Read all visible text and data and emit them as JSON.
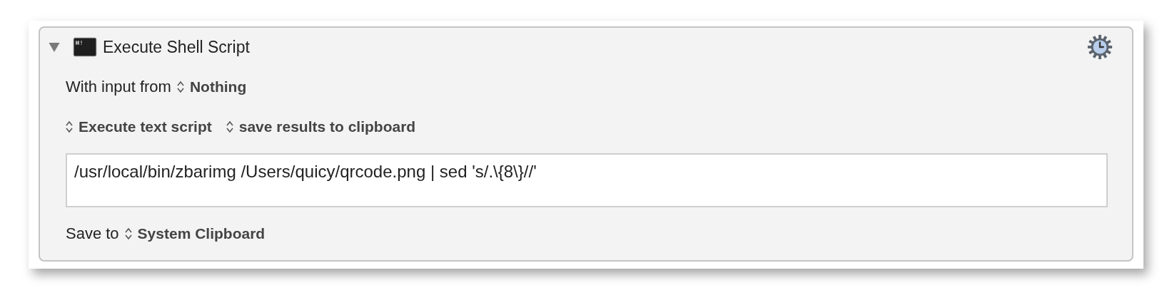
{
  "action": {
    "title": "Execute Shell Script",
    "expanded": true
  },
  "input_row": {
    "label": "With input from",
    "value": "Nothing"
  },
  "options": [
    {
      "value": "Execute text script"
    },
    {
      "value": "save results to clipboard"
    }
  ],
  "script": {
    "value": "/usr/local/bin/zbarimg /Users/quicy/qrcode.png | sed 's/.\\{8\\}//'"
  },
  "save_row": {
    "label": "Save to",
    "value": "System Clipboard"
  }
}
